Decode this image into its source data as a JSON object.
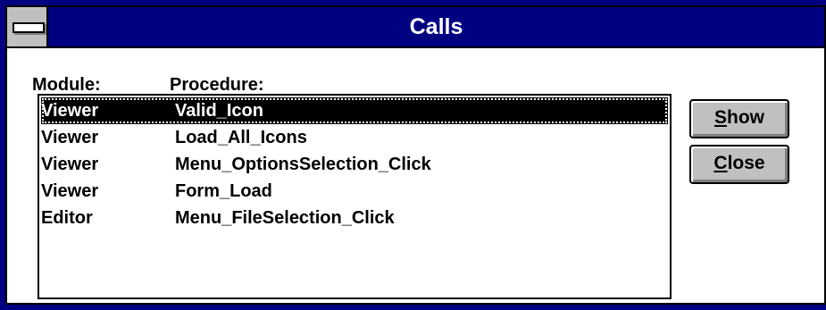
{
  "window": {
    "title": "Calls"
  },
  "headers": {
    "module": "Module:",
    "procedure": "Procedure:"
  },
  "rows": [
    {
      "module": "Viewer",
      "procedure": "Valid_Icon",
      "selected": true
    },
    {
      "module": "Viewer",
      "procedure": "Load_All_Icons"
    },
    {
      "module": "Viewer",
      "procedure": "Menu_OptionsSelection_Click"
    },
    {
      "module": "Viewer",
      "procedure": "Form_Load"
    },
    {
      "module": "Editor",
      "procedure": "Menu_FileSelection_Click"
    }
  ],
  "buttons": {
    "show": {
      "mnemonic": "S",
      "rest": "how"
    },
    "close": {
      "mnemonic": "C",
      "rest": "lose"
    }
  },
  "colors": {
    "titlebar": "#000080",
    "selection": "#000000",
    "button_face": "#c0c0c0"
  }
}
